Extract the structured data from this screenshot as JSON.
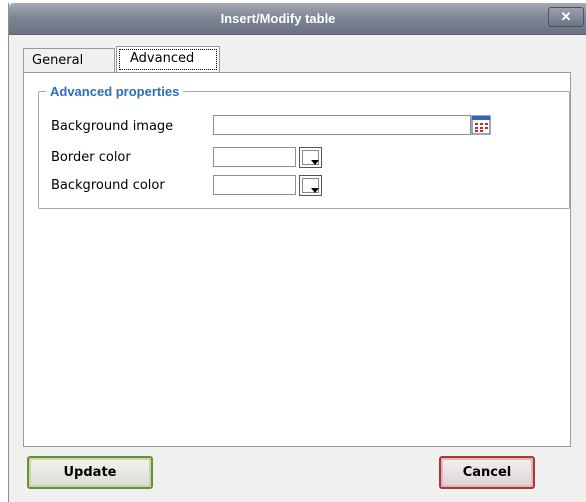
{
  "window": {
    "title": "Insert/Modify table",
    "close_label": "✕"
  },
  "tabs": [
    {
      "label": "General",
      "active": false
    },
    {
      "label": "Advanced",
      "active": true
    }
  ],
  "fieldset": {
    "legend": "Advanced properties"
  },
  "fields": {
    "background_image": {
      "label": "Background image",
      "value": ""
    },
    "border_color": {
      "label": "Border color",
      "value": ""
    },
    "background_color": {
      "label": "Background color",
      "value": ""
    }
  },
  "buttons": {
    "update": "Update",
    "cancel": "Cancel"
  },
  "icons": {
    "browse": "browse-image-icon",
    "color_picker": "color-picker-icon",
    "close": "close-icon"
  },
  "colors": {
    "legend": "#2b6fb6",
    "update_border": "#6b8e3a",
    "cancel_border": "#a33a3a",
    "titlebar": "#7f8797"
  }
}
